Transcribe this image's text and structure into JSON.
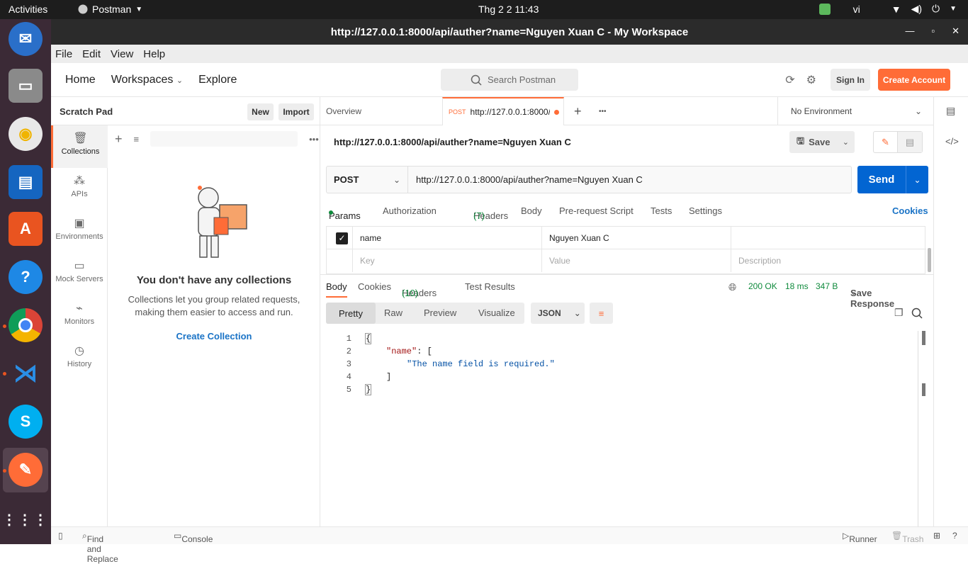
{
  "system": {
    "activities": "Activities",
    "app_name": "Postman",
    "clock": "Thg 2 2  11:43",
    "lang": "vi"
  },
  "window": {
    "title": "http://127.0.0.1:8000/api/auther?name=Nguyen Xuan C - My Workspace"
  },
  "menu": [
    "File",
    "Edit",
    "View",
    "Help"
  ],
  "header": {
    "nav": [
      "Home",
      "Workspaces",
      "Explore"
    ],
    "search_placeholder": "Search Postman",
    "sign_in": "Sign In",
    "create_account": "Create Account"
  },
  "sidebar": {
    "title": "Scratch Pad",
    "new_label": "New",
    "import_label": "Import",
    "rail": [
      {
        "label": "Collections",
        "icon": "collections-icon"
      },
      {
        "label": "APIs",
        "icon": "apis-icon"
      },
      {
        "label": "Environments",
        "icon": "environments-icon"
      },
      {
        "label": "Mock Servers",
        "icon": "mock-servers-icon"
      },
      {
        "label": "Monitors",
        "icon": "monitors-icon"
      },
      {
        "label": "History",
        "icon": "history-icon"
      }
    ],
    "empty_title": "You don't have any collections",
    "empty_text": "Collections let you group related requests, making them easier to access and run.",
    "create_collection": "Create Collection"
  },
  "tabs": {
    "overview": "Overview",
    "active_method": "POST",
    "active_url": "http://127.0.0.1:8000/a",
    "environment": "No Environment"
  },
  "request": {
    "title": "http://127.0.0.1:8000/api/auther?name=Nguyen Xuan C",
    "save": "Save",
    "method": "POST",
    "url": "http://127.0.0.1:8000/api/auther?name=Nguyen Xuan C",
    "send": "Send",
    "subtabs": [
      "Params",
      "Authorization",
      "Headers",
      "Body",
      "Pre-request Script",
      "Tests",
      "Settings"
    ],
    "headers_count": "(7)",
    "cookies": "Cookies",
    "params": [
      {
        "key": "name",
        "value": "Nguyen Xuan C",
        "description": ""
      }
    ],
    "placeholder_key": "Key",
    "placeholder_value": "Value",
    "placeholder_desc": "Description"
  },
  "response": {
    "tabs": [
      "Body",
      "Cookies",
      "Headers",
      "Test Results"
    ],
    "headers_count": "(10)",
    "status": "200 OK",
    "time": "18 ms",
    "size": "347 B",
    "save_response": "Save Response",
    "formats": [
      "Pretty",
      "Raw",
      "Preview",
      "Visualize"
    ],
    "lang": "JSON",
    "lines": [
      "1",
      "2",
      "3",
      "4",
      "5"
    ],
    "code": {
      "open": "{",
      "key": "\"name\"",
      "colon": ": [",
      "msg": "\"The name field is required.\"",
      "close_arr": "]",
      "close": "}"
    }
  },
  "statusbar": {
    "find_replace": "Find and Replace",
    "console": "Console",
    "runner": "Runner",
    "trash": "Trash"
  },
  "colors": {
    "accent": "#ff6c37",
    "send": "#0265d2",
    "ok": "#0f8a3c"
  }
}
